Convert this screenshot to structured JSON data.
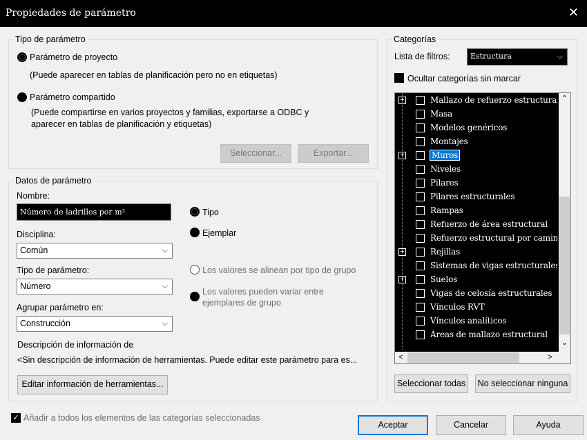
{
  "window": {
    "title": "Propiedades de parámetro",
    "close_label": "✕"
  },
  "tipo_parametro": {
    "legend": "Tipo de parámetro",
    "proyecto_label": "Parámetro de proyecto",
    "proyecto_desc": "(Puede aparecer en tablas de planificación pero no en etiquetas)",
    "compartido_label": "Parámetro compartido",
    "compartido_desc_1": "(Puede compartirse en varios proyectos y familias, exportarse a ODBC y",
    "compartido_desc_2": "aparecer en tablas de planificación y etiquetas)",
    "seleccionar_label": "Seleccionar...",
    "exportar_label": "Exportar..."
  },
  "datos_parametro": {
    "legend": "Datos de parámetro",
    "nombre_label": "Nombre:",
    "nombre_value": "Número de ladrillos por m²",
    "disciplina_label": "Disciplina:",
    "disciplina_value": "Común",
    "tipo_param_label": "Tipo de parámetro:",
    "tipo_param_value": "Número",
    "agrupar_label": "Agrupar parámetro en:",
    "agrupar_value": "Construcción",
    "tipo_radio": "Tipo",
    "ejemplar_radio": "Ejemplar",
    "alinean_label": "Los valores se alinean por tipo de grupo",
    "variar_label_1": "Los valores pueden variar entre",
    "variar_label_2": "ejemplares de grupo",
    "descripcion_title": "Descripción de información de",
    "descripcion_text": "<Sin descripción de información de herramientas. Puede editar este parámetro para es...",
    "editar_button": "Editar información de herramientas..."
  },
  "categorias": {
    "legend": "Categorías",
    "filtro_label": "Lista de filtros:",
    "filtro_value": "Estructura",
    "ocultar_label": "Ocultar categorías sin marcar",
    "items": [
      {
        "label": "Mallazo de refuerzo estructural",
        "expandable": true,
        "highlight": false
      },
      {
        "label": "Masa",
        "expandable": false,
        "highlight": false
      },
      {
        "label": "Modelos genéricos",
        "expandable": false,
        "highlight": false
      },
      {
        "label": "Montajes",
        "expandable": false,
        "highlight": false
      },
      {
        "label": "Muros",
        "expandable": true,
        "highlight": true
      },
      {
        "label": "Niveles",
        "expandable": false,
        "highlight": false
      },
      {
        "label": "Pilares",
        "expandable": false,
        "highlight": false
      },
      {
        "label": "Pilares estructurales",
        "expandable": false,
        "highlight": false
      },
      {
        "label": "Rampas",
        "expandable": false,
        "highlight": false
      },
      {
        "label": "Refuerzo de área estructural",
        "expandable": false,
        "highlight": false
      },
      {
        "label": "Refuerzo estructural por camino",
        "expandable": false,
        "highlight": false
      },
      {
        "label": "Rejillas",
        "expandable": true,
        "highlight": false
      },
      {
        "label": "Sistemas de vigas estructurales",
        "expandable": false,
        "highlight": false
      },
      {
        "label": "Suelos",
        "expandable": true,
        "highlight": false
      },
      {
        "label": "Vigas de celosía estructurales",
        "expandable": false,
        "highlight": false
      },
      {
        "label": "Vínculos RVT",
        "expandable": false,
        "highlight": false
      },
      {
        "label": "Vínculos analíticos",
        "expandable": false,
        "highlight": false
      },
      {
        "label": "Áreas de mallazo estructural",
        "expandable": false,
        "highlight": false
      }
    ],
    "seleccionar_todas": "Seleccionar todas",
    "no_seleccionar": "No seleccionar ninguna"
  },
  "footer": {
    "anadir_label": "Añadir a todos los elementos de las categorías seleccionadas",
    "aceptar": "Aceptar",
    "cancelar": "Cancelar",
    "ayuda": "Ayuda"
  }
}
